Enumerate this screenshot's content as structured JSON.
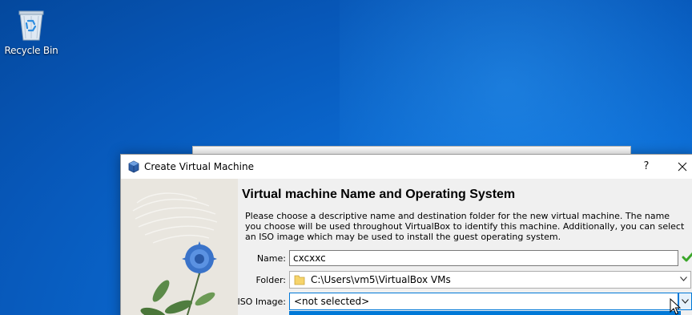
{
  "desktop": {
    "recycle_bin_label": "Recycle Bin"
  },
  "dialog": {
    "title": "Create Virtual Machine",
    "help_label": "?",
    "heading": "Virtual machine Name and Operating System",
    "description": "Please choose a descriptive name and destination folder for the new virtual machine. The name you choose will be used throughout VirtualBox to identify this machine. Additionally, you can select an ISO image which may be used to install the guest operating system.",
    "name": {
      "label": "Name:",
      "value": "cxcxxc"
    },
    "folder": {
      "label": "Folder:",
      "value": "C:\\Users\\vm5\\VirtualBox VMs"
    },
    "iso": {
      "label": "ISO Image:",
      "value": "<not selected>"
    }
  },
  "colors": {
    "accent": "#0078d7",
    "desktop_blue": "#0a64cc",
    "valid_check": "#3aa629"
  },
  "icons": [
    "recycle-bin-icon",
    "virtualbox-icon",
    "close-icon",
    "check-icon",
    "folder-icon",
    "chevron-down-icon",
    "mouse-cursor-icon"
  ]
}
